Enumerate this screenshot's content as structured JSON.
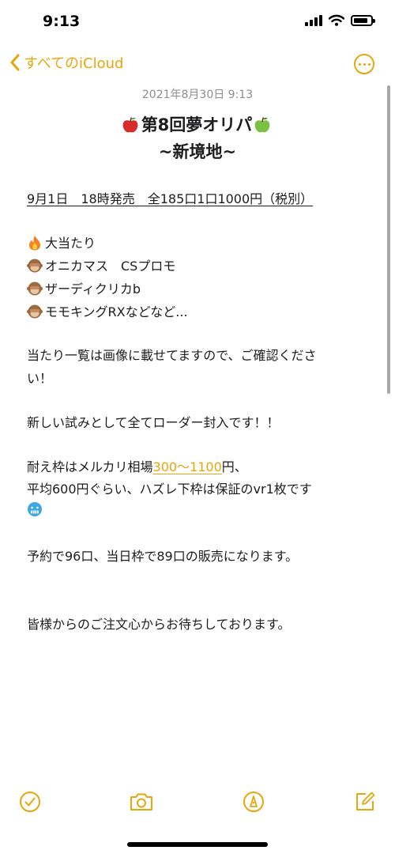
{
  "status_bar": {
    "time": "9:13",
    "battery_level": 0.85
  },
  "nav": {
    "back_label": "すべてのiCloud",
    "more_icon": "ellipsis-circle-icon",
    "back_icon": "chevron-left-icon"
  },
  "note": {
    "date": "2021年8月30日 9:13",
    "title": {
      "emoji_left": "red-apple-emoji",
      "text": "第8回夢オリパ",
      "emoji_right": "green-apple-emoji",
      "subtitle": "~新境地~"
    },
    "sale_info": "9月1日　18時発売　全185口1口1000円（税別）",
    "prizes": [
      {
        "emoji": "fire-emoji",
        "text": "大当たり"
      },
      {
        "emoji": "see-no-evil-monkey-emoji",
        "text": "オニカマス　CSプロモ"
      },
      {
        "emoji": "see-no-evil-monkey-emoji",
        "text": "ザーディクリカb"
      },
      {
        "emoji": "see-no-evil-monkey-emoji",
        "text": "モモキングRXなどなど..."
      }
    ],
    "list_notice_1": "当たり一覧は画像に載せてますので、ご確認くださ",
    "list_notice_2": "い！",
    "loader_notice": "新しい試みとして全てローダー封入です！！",
    "frame_prefix": "耐え枠はメルカリ相場",
    "frame_link": "300〜1100",
    "frame_suffix": "円、",
    "average_line": "平均600円ぐらい、ハズレ下枠は保証のvr1枚です",
    "average_emoji": "cold-face-emoji",
    "reservation": "予約で96口、当日枠で89口の販売になります。",
    "closing": "皆様からのご注文心からお待ちしております。"
  },
  "toolbar": {
    "icons": [
      "checklist-icon",
      "camera-icon",
      "markup-pen-icon",
      "compose-icon"
    ]
  },
  "colors": {
    "accent": "#e5a70b",
    "text": "#1c1c1e",
    "secondary": "#8e8e93"
  }
}
